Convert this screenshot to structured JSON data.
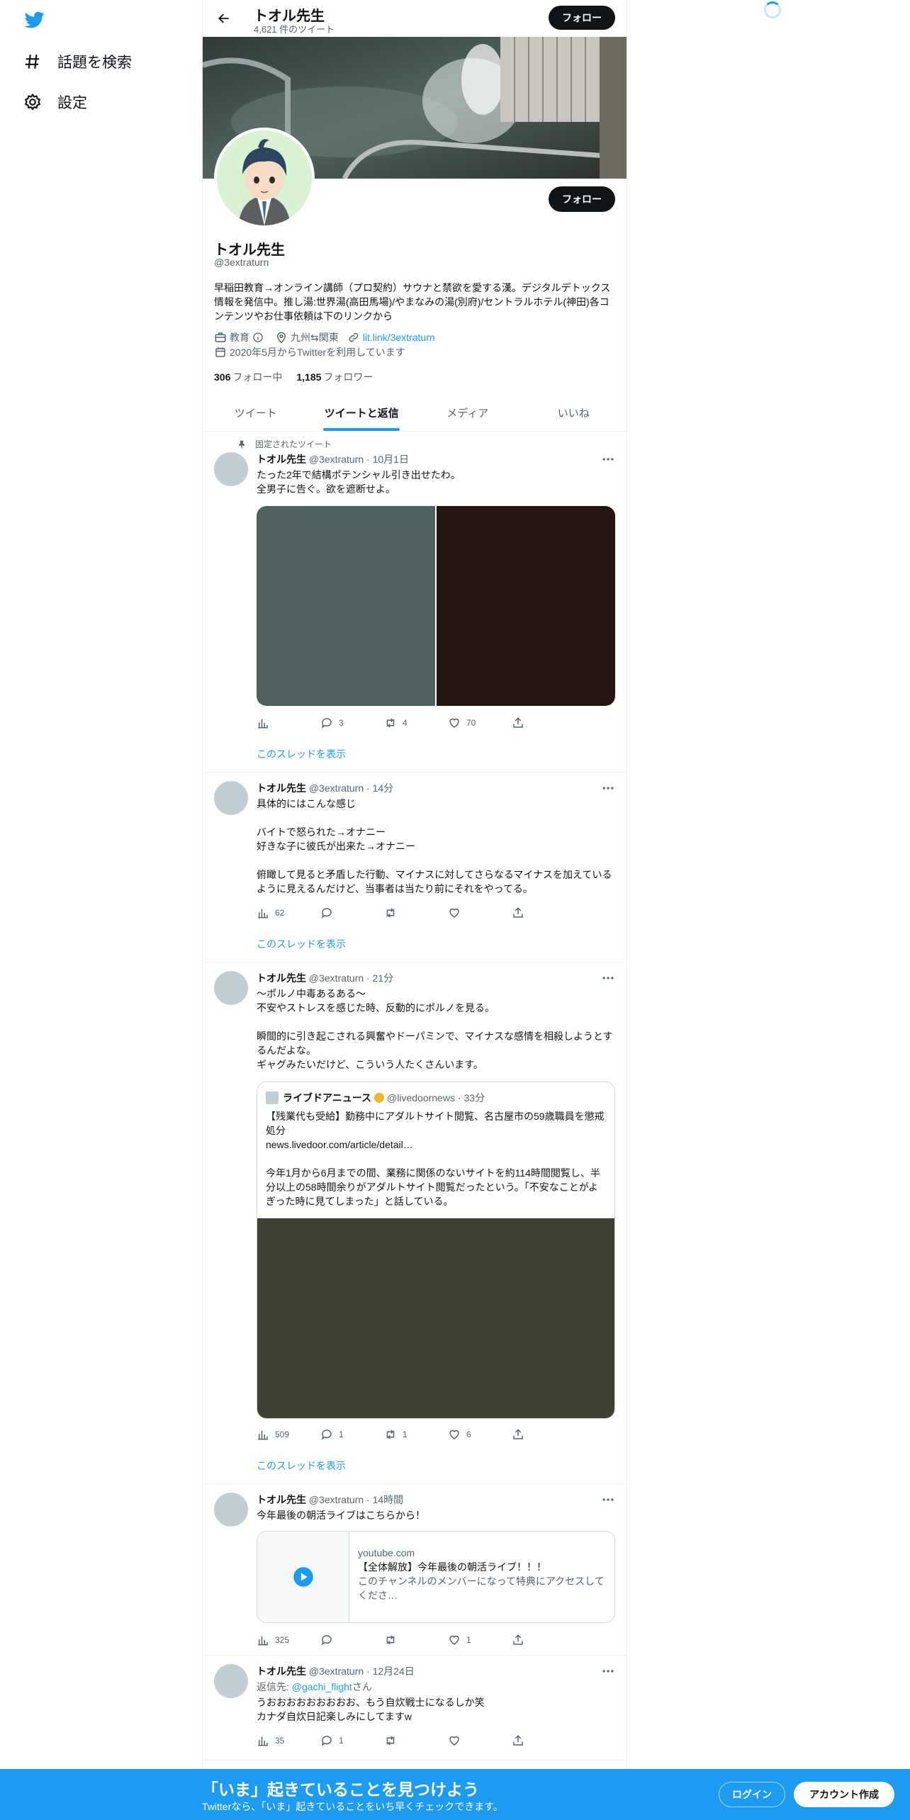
{
  "nav": {
    "logo": "twitter-bird-icon",
    "items": [
      {
        "label": "話題を検索",
        "icon": "hashtag-icon"
      },
      {
        "label": "設定",
        "icon": "gear-icon"
      }
    ]
  },
  "header": {
    "name": "トオル先生",
    "tweet_count": "4,621 件のツイート",
    "follow_label": "フォロー"
  },
  "profile": {
    "name": "トオル先生",
    "handle": "@3extraturn",
    "bio": "早稲田教育→オンライン講師（プロ契約）サウナと禁欲を愛する漢。デジタルデトックス情報を発信中。推し湯:世界湯(高田馬場)/やまなみの湯(別府)/セントラルホテル(神田)各コンテンツやお仕事依頼は下のリンクから",
    "category": "教育",
    "location": "九州⇆関東",
    "url": "lit.link/3extraturn",
    "joined": "2020年5月からTwitterを利用しています",
    "following_count": "306",
    "following_label": "フォロー中",
    "followers_count": "1,185",
    "followers_label": "フォロワー",
    "follow_label": "フォロー"
  },
  "tabs": [
    "ツイート",
    "ツイートと返信",
    "メディア",
    "いいね"
  ],
  "tweets": [
    {
      "pinned_label": "固定されたツイート",
      "name": "トオル先生",
      "handle": "@3extraturn",
      "time": "· 10月1日",
      "text": "たった2年で結構ポテンシャル引き出せたわ。\n全男子に告ぐ。欲を遮断せよ。",
      "views": "",
      "replies": "3",
      "retweets": "4",
      "likes": "70",
      "thread": "このスレッドを表示",
      "media_colors": [
        "#4d625f",
        "#241510"
      ]
    },
    {
      "name": "トオル先生",
      "handle": "@3extraturn",
      "time": "· 14分",
      "text": "具体的にはこんな感じ\n\nバイトで怒られた→オナニー\n好きな子に彼氏が出来た→オナニー\n\n俯瞰して見ると矛盾した行動、マイナスに対してさらなるマイナスを加えているように見えるんだけど、当事者は当たり前にそれをやってる。",
      "views": "62",
      "replies": "",
      "retweets": "",
      "likes": "",
      "thread": "このスレッドを表示"
    },
    {
      "name": "トオル先生",
      "handle": "@3extraturn",
      "time": "· 21分",
      "text": "〜ポルノ中毒あるある〜\n不安やストレスを感じた時、反動的にポルノを見る。\n\n瞬間的に引き起こされる興奮やドーパミンで、マイナスな感情を相殺しようとするんだよな。\nギャグみたいだけど、こういう人たくさんいます。",
      "views": "509",
      "replies": "1",
      "retweets": "1",
      "likes": "6",
      "thread": "このスレッドを表示",
      "quote": {
        "name": "ライブドアニュース",
        "handle": "@livedoornews",
        "time": "· 33分",
        "title": "【残業代も受給】勤務中にアダルトサイト閲覧、名古屋市の59歳職員を懲戒処分",
        "link": "news.livedoor.com/article/detail…",
        "body": "今年1月から6月までの間、業務に関係のないサイトを約114時間閲覧し、半分以上の58時間余りがアダルトサイト閲覧だったという。「不安なことがよぎった時に見てしまった」と話している。",
        "media_color": "#3f4034"
      }
    },
    {
      "name": "トオル先生",
      "handle": "@3extraturn",
      "time": "· 14時間",
      "text": "今年最後の朝活ライブはこちらから！",
      "views": "325",
      "replies": "",
      "retweets": "",
      "likes": "1",
      "card": {
        "domain": "youtube.com",
        "title": "【全体解放】今年最後の朝活ライブ！！！",
        "desc": "このチャンネルのメンバーになって特典にアクセスしてくださ…"
      }
    },
    {
      "name": "トオル先生",
      "handle": "@3extraturn",
      "time": "· 12月24日",
      "reply_prefix": "返信先: ",
      "reply_to": "@gachi_flight",
      "reply_suffix": "さん",
      "text": "うおおおおおおおおお、もう自炊戦士になるしか笑\nカナダ自炊日記楽しみにしてますw",
      "views": "35",
      "replies": "1",
      "retweets": "",
      "likes": ""
    }
  ],
  "bottom_bar": {
    "title": "「いま」起きていることを見つけよう",
    "subtitle": "Twitterなら、「いま」起きていることをいち早くチェックできます。",
    "login": "ログイン",
    "signup": "アカウント作成"
  },
  "colors": {
    "accent": "#1d9bf0",
    "text": "#0f1419",
    "muted": "#536471"
  }
}
